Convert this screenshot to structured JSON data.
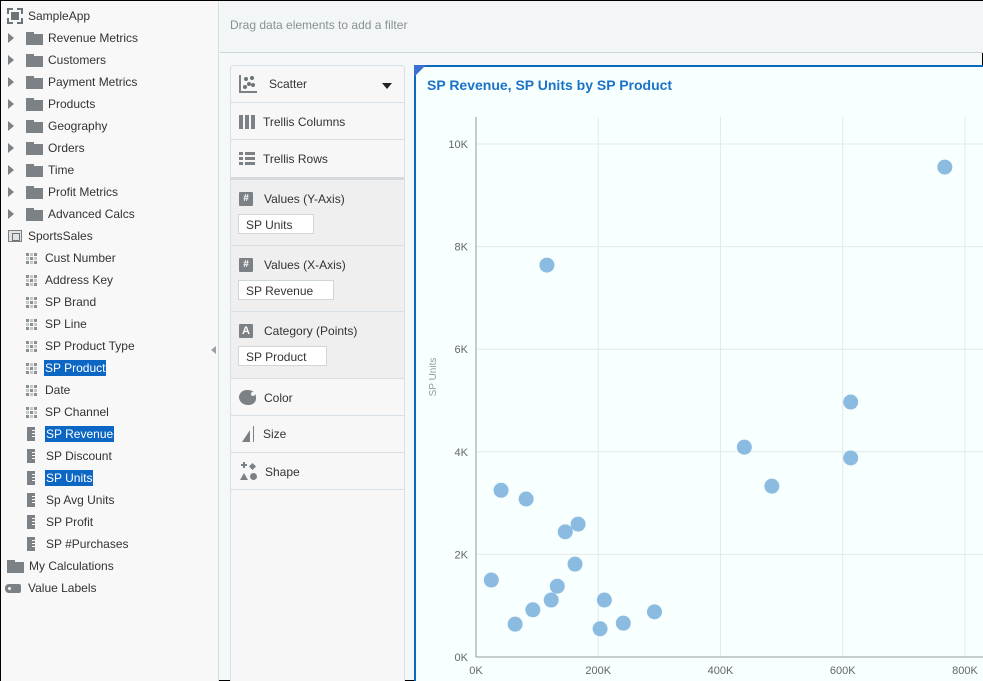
{
  "data_panel": {
    "app": {
      "label": "SampleApp",
      "icon": "app-icon"
    },
    "folders": [
      {
        "label": "Revenue Metrics",
        "icon": "folder-icon"
      },
      {
        "label": "Customers",
        "icon": "folder-icon"
      },
      {
        "label": "Payment Metrics",
        "icon": "folder-icon"
      },
      {
        "label": "Products",
        "icon": "folder-icon"
      },
      {
        "label": "Geography",
        "icon": "folder-icon"
      },
      {
        "label": "Orders",
        "icon": "folder-icon"
      },
      {
        "label": "Time",
        "icon": "folder-icon"
      },
      {
        "label": "Profit Metrics",
        "icon": "folder-icon"
      },
      {
        "label": "Advanced Calcs",
        "icon": "folder-icon"
      }
    ],
    "subject_area": {
      "label": "SportsSales",
      "icon": "subject-area-icon"
    },
    "columns": [
      {
        "label": "Cust Number",
        "type": "attribute",
        "selected": false
      },
      {
        "label": "Address Key",
        "type": "attribute",
        "selected": false
      },
      {
        "label": "SP Brand",
        "type": "attribute",
        "selected": false
      },
      {
        "label": "SP Line",
        "type": "attribute",
        "selected": false
      },
      {
        "label": "SP Product Type",
        "type": "attribute",
        "selected": false
      },
      {
        "label": "SP Product",
        "type": "attribute",
        "selected": true
      },
      {
        "label": "Date",
        "type": "attribute",
        "selected": false
      },
      {
        "label": "SP Channel",
        "type": "attribute",
        "selected": false
      },
      {
        "label": "SP Revenue",
        "type": "measure",
        "selected": true
      },
      {
        "label": "SP Discount",
        "type": "measure",
        "selected": false
      },
      {
        "label": "SP Units",
        "type": "measure",
        "selected": true
      },
      {
        "label": "Sp Avg Units",
        "type": "measure",
        "selected": false
      },
      {
        "label": "SP Profit",
        "type": "measure",
        "selected": false
      },
      {
        "label": "SP #Purchases",
        "type": "measure",
        "selected": false
      }
    ],
    "my_calculations": {
      "label": "My Calculations",
      "icon": "folder-icon"
    },
    "value_labels": {
      "label": "Value Labels",
      "icon": "tag-icon"
    }
  },
  "filter_bar": {
    "hint": "Drag data elements to add a filter"
  },
  "grammar": {
    "chart_type": "Scatter",
    "trellis_columns": "Trellis Columns",
    "trellis_rows": "Trellis Rows",
    "values_y": {
      "label": "Values (Y-Axis)",
      "value": "SP Units"
    },
    "values_x": {
      "label": "Values (X-Axis)",
      "value": "SP Revenue"
    },
    "category": {
      "label": "Category (Points)",
      "value": "SP Product"
    },
    "color": "Color",
    "size": "Size",
    "shape": "Shape"
  },
  "colors": {
    "accent": "#0b6abf",
    "title": "#1a73c7",
    "point": "#7fb4df",
    "selection": "#0b67c3"
  },
  "chart_data": {
    "type": "scatter",
    "title": "SP Revenue, SP Units by SP Product",
    "xlabel": "",
    "ylabel": "SP Units",
    "xlim": [
      0,
      800000
    ],
    "ylim": [
      0,
      10000
    ],
    "x_ticks": [
      0,
      200000,
      400000,
      600000,
      800000
    ],
    "x_tick_labels": [
      "0K",
      "200K",
      "400K",
      "600K",
      "800K"
    ],
    "y_ticks": [
      0,
      2000,
      4000,
      6000,
      8000,
      10000
    ],
    "y_tick_labels": [
      "0K",
      "2K",
      "4K",
      "6K",
      "8K",
      "10K"
    ],
    "grid": true,
    "legend": "none",
    "series": [
      {
        "name": "SP Product",
        "points": [
          {
            "x": 25000,
            "y": 1500
          },
          {
            "x": 41000,
            "y": 3250
          },
          {
            "x": 64000,
            "y": 640
          },
          {
            "x": 82000,
            "y": 3080
          },
          {
            "x": 93000,
            "y": 920
          },
          {
            "x": 116000,
            "y": 7640
          },
          {
            "x": 123000,
            "y": 1110
          },
          {
            "x": 133000,
            "y": 1380
          },
          {
            "x": 146000,
            "y": 2440
          },
          {
            "x": 162000,
            "y": 1810
          },
          {
            "x": 167000,
            "y": 2590
          },
          {
            "x": 203000,
            "y": 550
          },
          {
            "x": 210000,
            "y": 1110
          },
          {
            "x": 241000,
            "y": 660
          },
          {
            "x": 292000,
            "y": 880
          },
          {
            "x": 439000,
            "y": 4090
          },
          {
            "x": 484000,
            "y": 3330
          },
          {
            "x": 613000,
            "y": 4970
          },
          {
            "x": 613000,
            "y": 3880
          },
          {
            "x": 767000,
            "y": 9550
          }
        ]
      }
    ]
  }
}
